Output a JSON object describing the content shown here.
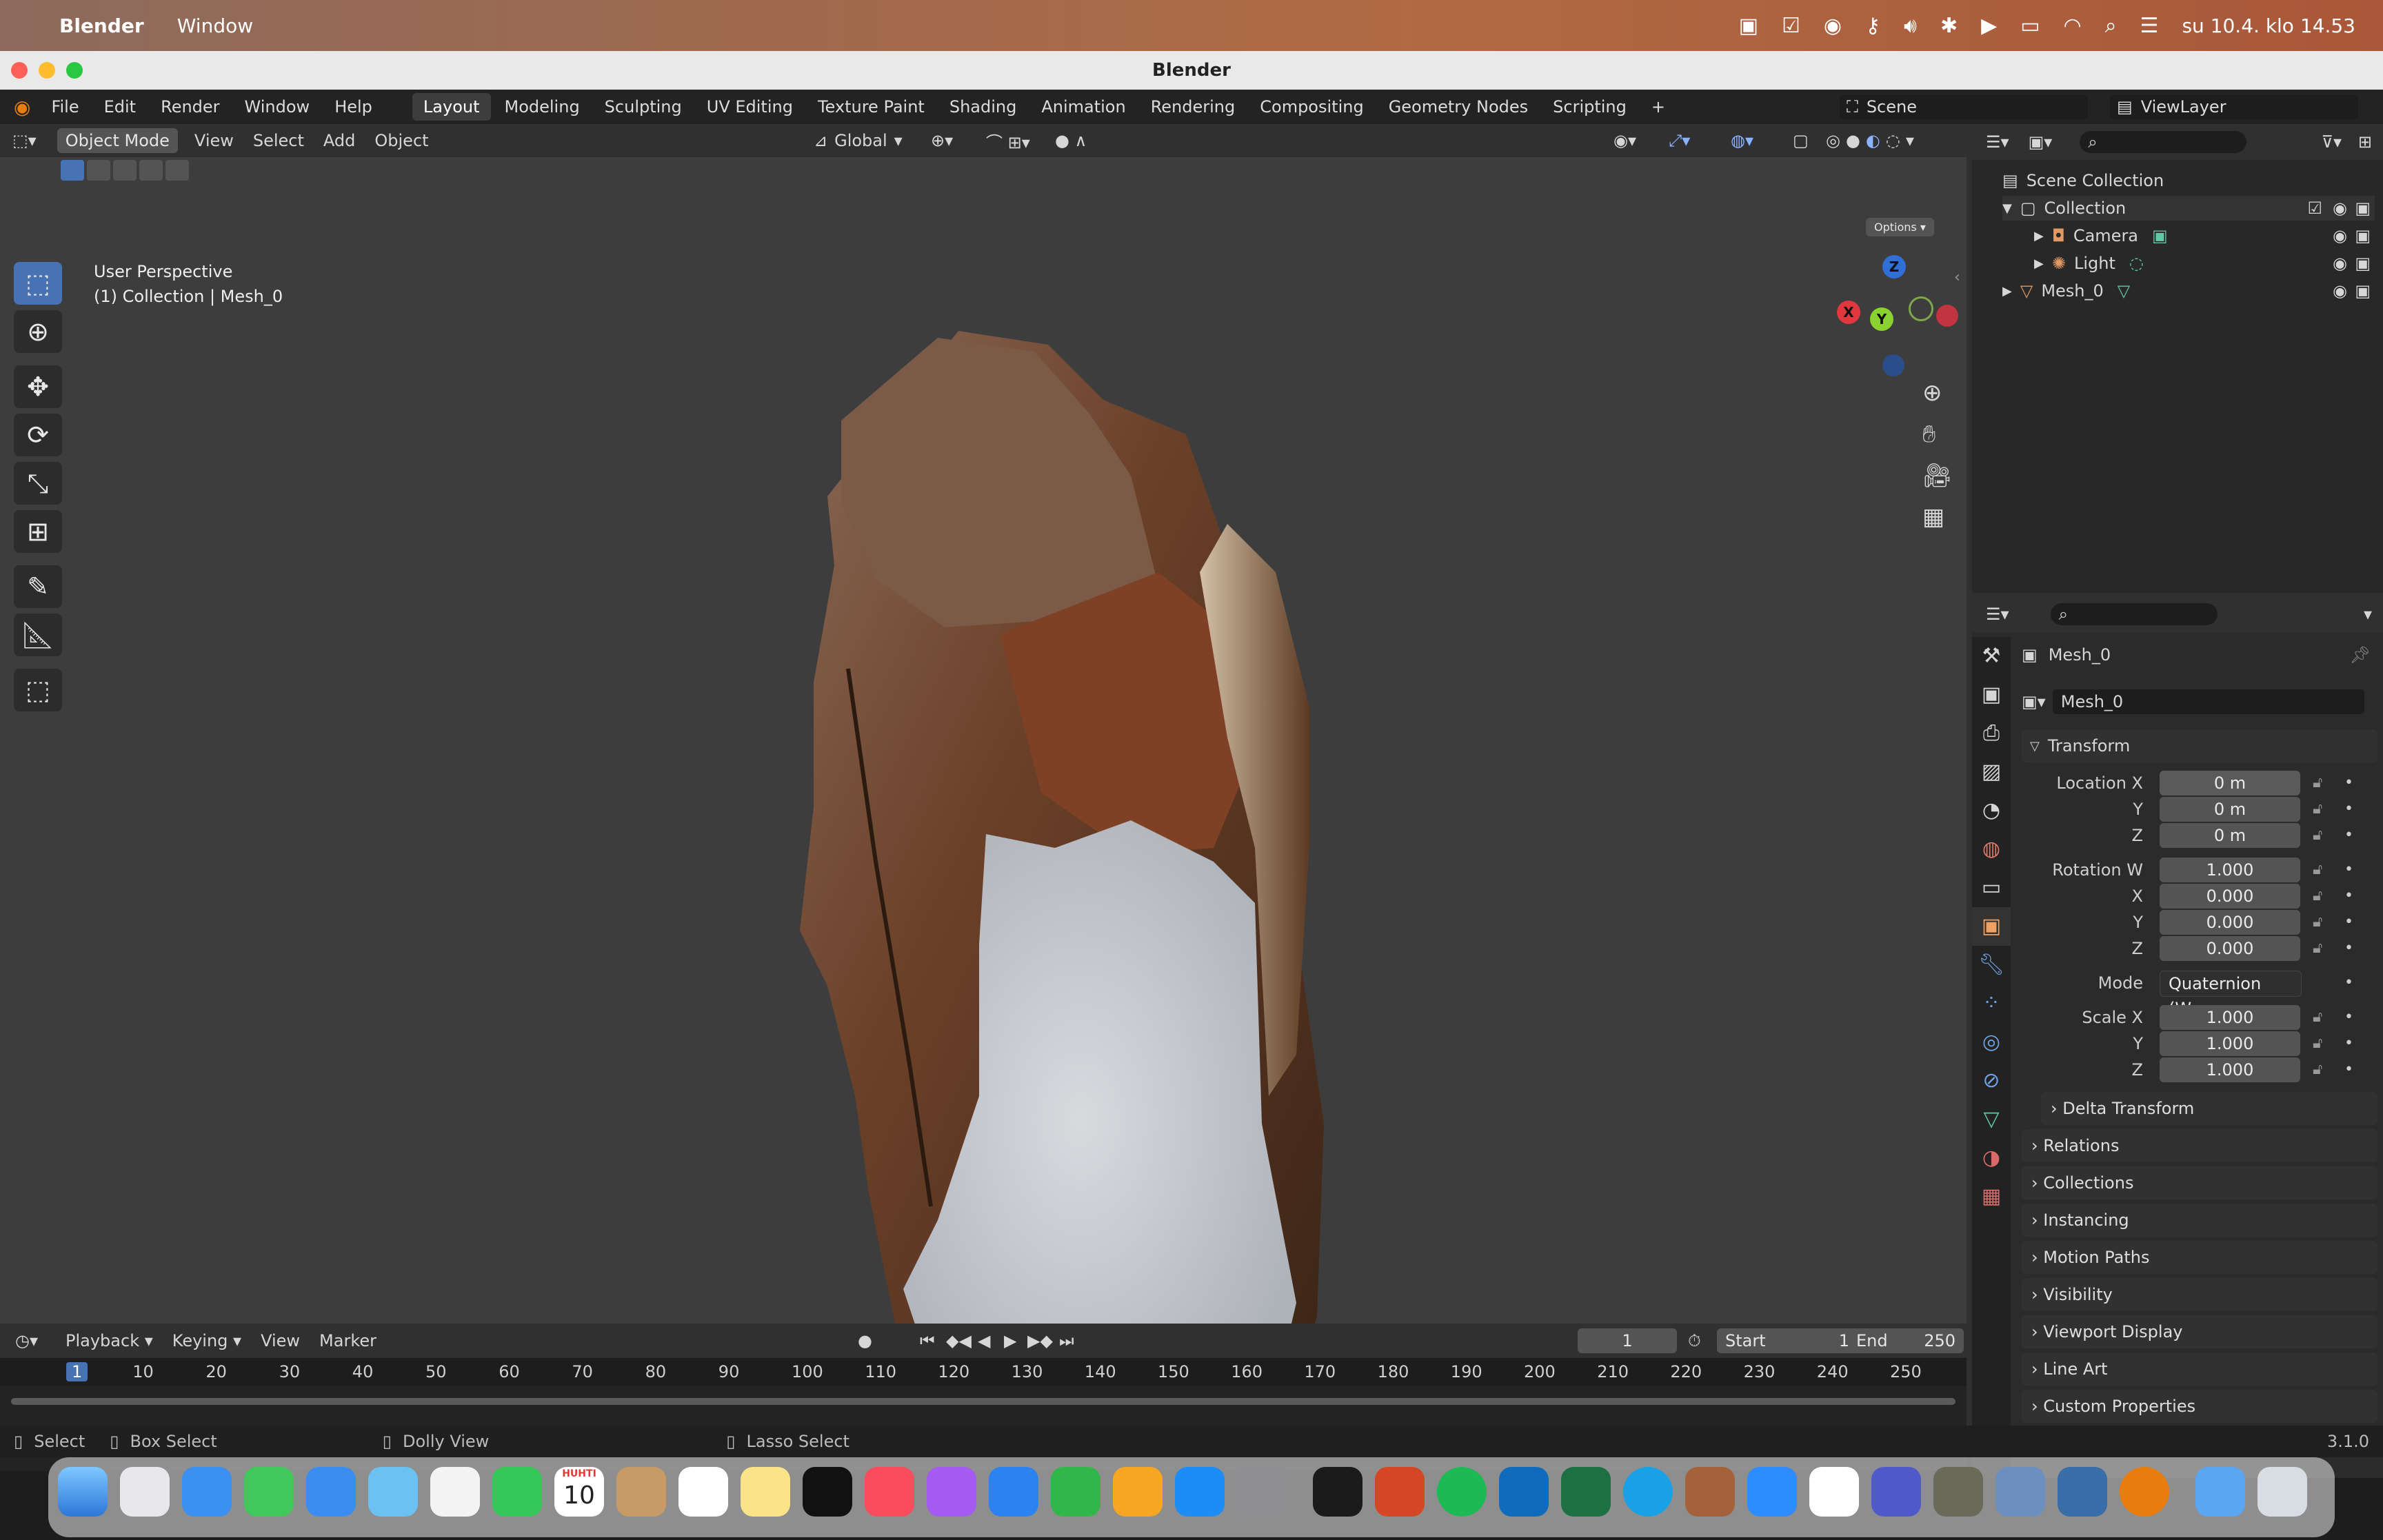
{
  "macos": {
    "app_name": "Blender",
    "menu_window": "Window",
    "clock": "su 10.4. klo 14.53"
  },
  "window": {
    "title": "Blender"
  },
  "topmenu": {
    "items": [
      "File",
      "Edit",
      "Render",
      "Window",
      "Help"
    ],
    "workspaces": [
      "Layout",
      "Modeling",
      "Sculpting",
      "UV Editing",
      "Texture Paint",
      "Shading",
      "Animation",
      "Rendering",
      "Compositing",
      "Geometry Nodes",
      "Scripting"
    ],
    "active_workspace": "Layout",
    "scene": "Scene",
    "viewlayer": "ViewLayer"
  },
  "viewport": {
    "mode": "Object Mode",
    "menus": [
      "View",
      "Select",
      "Add",
      "Object"
    ],
    "transform_orientation": "Global",
    "options": "Options",
    "perspective": "User Perspective",
    "context": "(1) Collection | Mesh_0",
    "gizmo": {
      "z": "Z",
      "y": "Y",
      "x": "X"
    }
  },
  "outliner": {
    "root": "Scene Collection",
    "collection": "Collection",
    "items": [
      {
        "name": "Camera",
        "icon": "camera-icon"
      },
      {
        "name": "Light",
        "icon": "light-icon"
      },
      {
        "name": "Mesh_0",
        "icon": "mesh-icon"
      }
    ]
  },
  "properties": {
    "object_name": "Mesh_0",
    "data_name": "Mesh_0",
    "transform_label": "Transform",
    "location": {
      "label": "Location X",
      "x": "0 m",
      "y": "0 m",
      "z": "0 m"
    },
    "rotation": {
      "label": "Rotation W",
      "w": "1.000",
      "x": "0.000",
      "y": "0.000",
      "z": "0.000"
    },
    "mode_label": "Mode",
    "mode_value": "Quaternion (W...",
    "scale": {
      "label": "Scale X",
      "x": "1.000",
      "y": "1.000",
      "z": "1.000"
    },
    "axis_labels": {
      "y": "Y",
      "z": "Z",
      "x": "X"
    },
    "delta_transform": "Delta Transform",
    "panels": [
      "Relations",
      "Collections",
      "Instancing",
      "Motion Paths",
      "Visibility",
      "Viewport Display",
      "Line Art",
      "Custom Properties"
    ]
  },
  "timeline": {
    "menus": [
      "Playback",
      "Keying",
      "View",
      "Marker"
    ],
    "current_frame": "1",
    "start_label": "Start",
    "start": "1",
    "end_label": "End",
    "end": "250",
    "ruler": [
      "1",
      "10",
      "20",
      "30",
      "40",
      "50",
      "60",
      "70",
      "80",
      "90",
      "100",
      "110",
      "120",
      "130",
      "140",
      "150",
      "160",
      "170",
      "180",
      "190",
      "200",
      "210",
      "220",
      "230",
      "240",
      "250"
    ]
  },
  "statusbar": {
    "select": "Select",
    "box_select": "Box Select",
    "dolly": "Dolly View",
    "lasso": "Lasso Select",
    "version": "3.1.0"
  },
  "dock": {
    "calendar_month": "HUHTI",
    "calendar_day": "10"
  },
  "colors": {
    "accent": "#4772b3",
    "viewport_bg": "#3d3d3d",
    "panel_bg": "#2b2b2b"
  }
}
